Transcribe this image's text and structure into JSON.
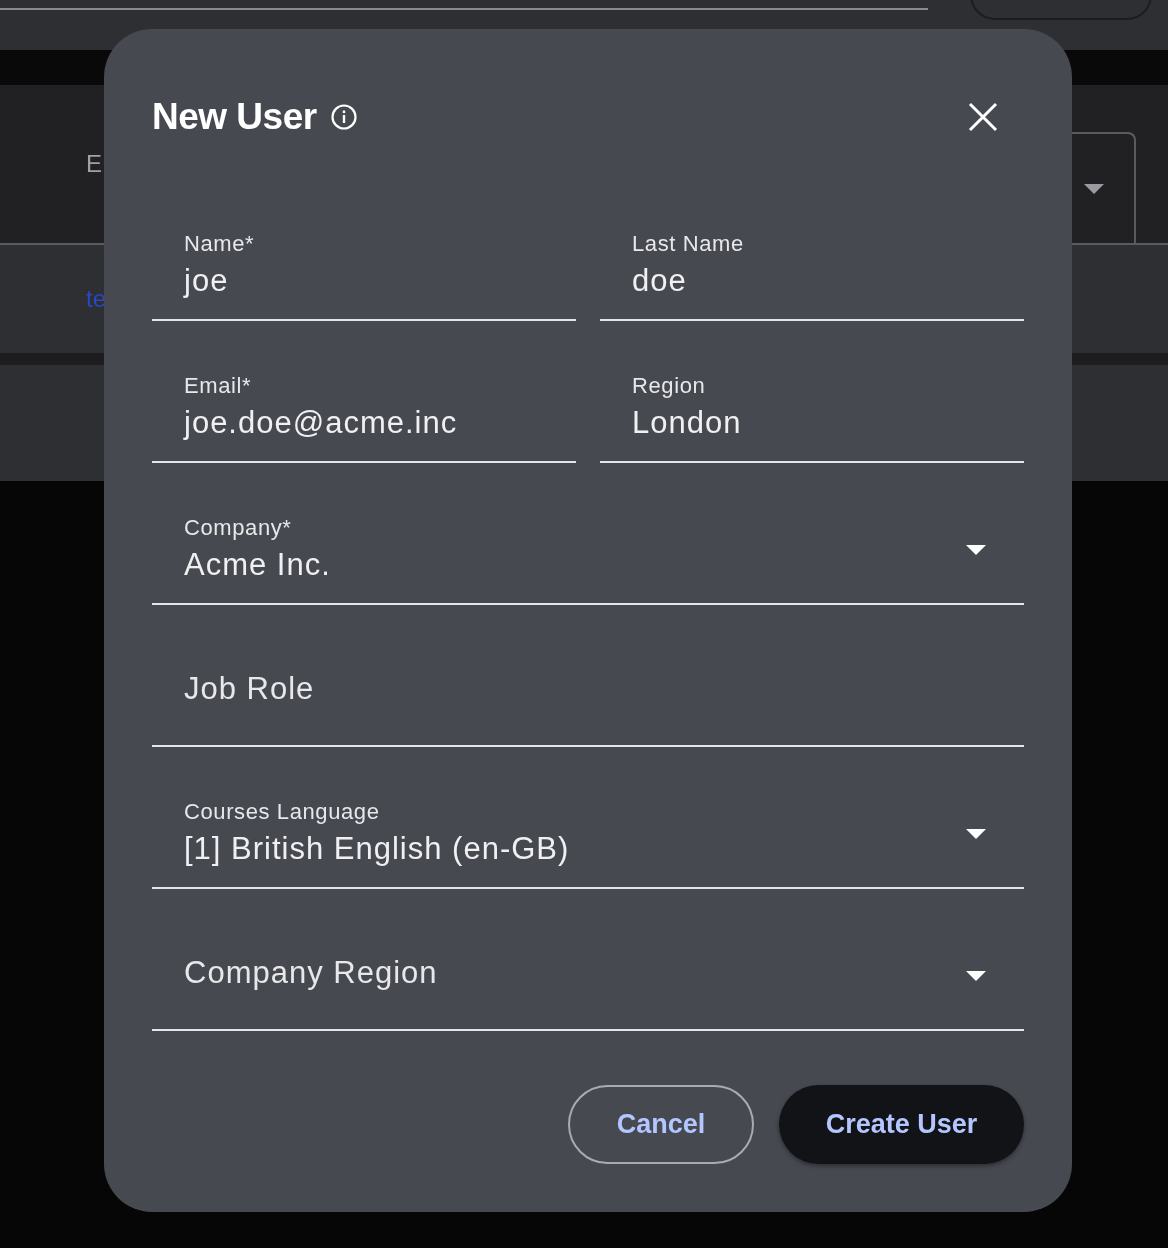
{
  "background": {
    "filter_label": "E",
    "link": "te"
  },
  "dialog": {
    "title": "New User",
    "fields": [
      {
        "kind": "text",
        "label": "Name*",
        "value": "joe",
        "half": true
      },
      {
        "kind": "text",
        "label": "Last Name",
        "value": "doe",
        "half": true
      },
      {
        "kind": "text",
        "label": "Email*",
        "value": "joe.doe@acme.inc",
        "half": true
      },
      {
        "kind": "text",
        "label": "Region",
        "value": "London",
        "half": true
      },
      {
        "kind": "select",
        "label": "Company*",
        "value": "Acme Inc.",
        "half": false
      },
      {
        "kind": "text",
        "label": "Job Role",
        "half": false
      },
      {
        "kind": "select",
        "label": "Courses Language",
        "value": "[1] British English (en-GB)",
        "half": false
      },
      {
        "kind": "select",
        "label": "Company Region",
        "half": false
      }
    ],
    "buttons": [
      {
        "kind": "outlined",
        "label": "Cancel"
      },
      {
        "kind": "filled",
        "label": "Create User"
      }
    ]
  }
}
